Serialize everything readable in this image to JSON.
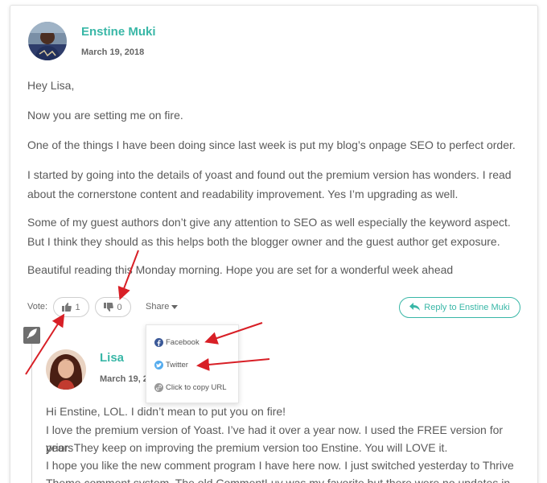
{
  "comment": {
    "author": "Enstine Muki",
    "date": "March 19, 2018",
    "paragraphs": [
      "Hey Lisa,",
      "Now you are setting me on fire.",
      "One of the things I have been doing since last week is put my blog’s onpage SEO to perfect order.",
      "I started by going into the details of yoast and found out the premium version has wonders. I read about the cornerstone content and readability improvement. Yes I’m upgrading as well.",
      "Some of my guest authors don’t give any attention to SEO as well especially the keyword aspect. But I think they should as this helps both the blogger owner and the guest author get exposure.",
      "Beautiful reading this Monday morning. Hope you are set for a wonderful week ahead"
    ]
  },
  "actions": {
    "vote_label": "Vote:",
    "upvotes": "1",
    "downvotes": "0",
    "share_label": "Share",
    "reply_label": "Reply to Enstine Muki"
  },
  "share_menu": {
    "items": [
      {
        "label": "Facebook",
        "icon": "facebook-icon",
        "color": "#3b5998"
      },
      {
        "label": "Twitter",
        "icon": "twitter-icon",
        "color": "#55acee"
      },
      {
        "label": "Click to copy URL",
        "icon": "link-icon",
        "color": "#999999"
      }
    ]
  },
  "reply": {
    "author": "Lisa",
    "date": "March 19, 2",
    "lines": [
      "Hi Enstine, LOL. I didn’t mean to put you on fire!",
      "I love the premium version of Yoast. I’ve had it over a year now. I used the FREE version for years",
      "prior. They keep on improving the premium version too Enstine. You will LOVE it.",
      "I hope you like the new comment program I have here now. I just switched yesterday to Thrive",
      "Theme comment system. The old CommentLuv was my favorite but there were no updates in"
    ]
  },
  "colors": {
    "accent": "#39b7a7",
    "annotation_arrow": "#d81f26"
  }
}
